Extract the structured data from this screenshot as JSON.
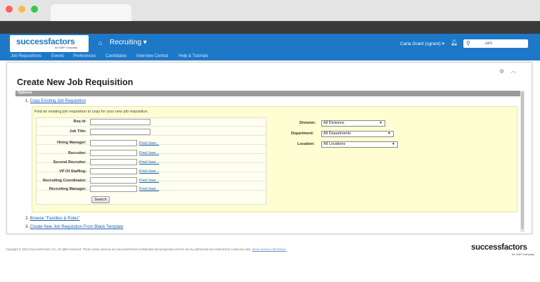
{
  "app": {
    "logo_text": "successfactors",
    "logo_sub": "An SAP Company",
    "module": "Recruiting ▾",
    "user": "Carla Grant (cgrant) ▾",
    "search_value": "Jam"
  },
  "subnav": [
    "Job Requisitions",
    "Events",
    "Preferences",
    "Candidates",
    "Interview Central",
    "Help & Tutorials"
  ],
  "page": {
    "title": "Create New Job Requisition",
    "options_label": "Options",
    "step1_num": "1.",
    "step1_link": "Copy Existing Job Requisition",
    "hint": "Find an existing job requisition to copy for your new job requisition.",
    "step2_num": "2.",
    "step2_link": "Browse \"Families & Roles\"",
    "step3_num": "3.",
    "step3_link": "Create New Job Requisition From Blank Template"
  },
  "form": {
    "labels": {
      "req_id": "Req Id:",
      "job_title": "Job Title:",
      "hiring_manager": "Hiring Manager:",
      "recruiter": "Recruiter:",
      "second_recruiter": "Second Recruiter:",
      "vp_staffing": "VP Of Staffing:",
      "recruiting_coordinator": "Recruiting Coordinator:",
      "recruiting_manager": "Recruiting Manager:"
    },
    "find_user": "Find User...",
    "search_button": "Search",
    "division_label": "Division:",
    "division_value": "All Divisions",
    "department_label": "Department:",
    "department_value": "All Departments",
    "location_label": "Location:",
    "location_value": "All Locations"
  },
  "footer": {
    "text": "Copyright © 2013 SuccessFactors, Inc. All rights reserved. These online services are SuccessFactors confidential and proprietary and for use by authorized SuccessFactors customers only.",
    "session_link": "Show session information.",
    "logo_text": "successfactors",
    "logo_sub": "An SAP Company"
  },
  "colors": {
    "header_blue": "#1e78c8",
    "panel_yellow": "#fefed2",
    "link_blue": "#1a5fb4"
  }
}
